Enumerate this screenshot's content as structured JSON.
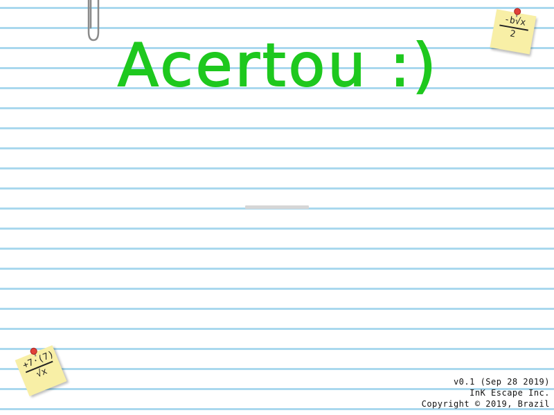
{
  "message": {
    "text": "Acertou :)",
    "color": "#1ec81e"
  },
  "loading_bar": {
    "progress": 0.0
  },
  "sticky_notes": {
    "top_right": {
      "numerator": "-b√x",
      "denominator": "2"
    },
    "bottom_left": {
      "numerator": "+7·(7)",
      "denominator": "√x"
    }
  },
  "credits": {
    "version": "v0.1 (Sep 28 2019)",
    "company": "InK Escape Inc.",
    "copyright": "Copyright © 2019, Brazil"
  },
  "icons": {
    "paperclip": "paperclip-icon",
    "pin": "pushpin-icon"
  }
}
